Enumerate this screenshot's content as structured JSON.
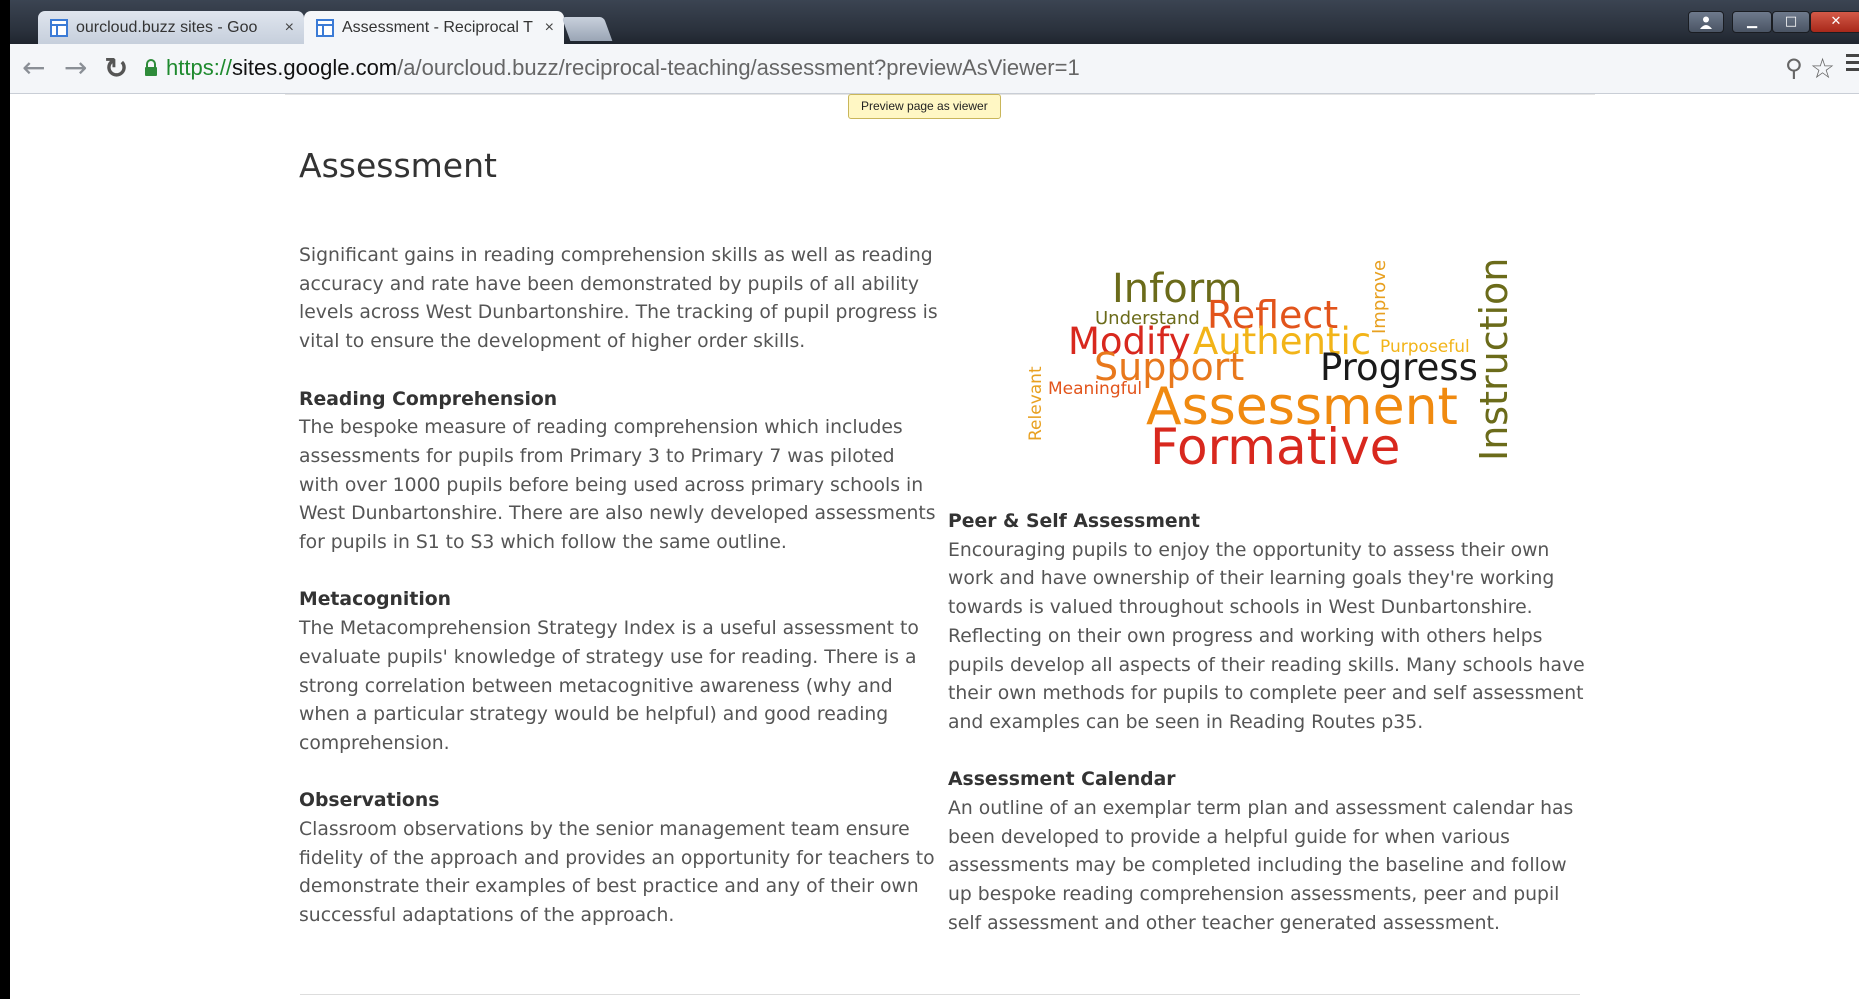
{
  "browser": {
    "tabs": [
      {
        "title": "ourcloud.buzz sites - Goo",
        "active": false
      },
      {
        "title": "Assessment - Reciprocal T",
        "active": true
      }
    ],
    "tab_close_symbol": "×",
    "url": {
      "scheme": "https://",
      "host": "sites.google.com",
      "path": "/a/ourcloud.buzz/reciprocal-teaching/assessment?previewAsViewer=1"
    },
    "window_controls": {
      "minimize": "▁",
      "maximize": "□",
      "close": "✕"
    }
  },
  "tooltip": "Preview page as viewer",
  "page": {
    "title": "Assessment",
    "left_column": [
      {
        "heading": "",
        "text": "Significant gains in reading comprehension skills as well as reading accuracy and rate have been demonstrated by pupils of all ability levels across West Dunbartonshire. The tracking of pupil progress is vital to ensure the development of higher order skills."
      },
      {
        "heading": "Reading Comprehension",
        "text": "The bespoke measure of reading comprehension which includes assessments for pupils from Primary 3 to Primary 7 was piloted with over 1000 pupils before being used across primary schools in West Dunbartonshire. There are also newly developed assessments for pupils in S1 to S3 which follow the same outline."
      },
      {
        "heading": "Metacognition",
        "text": "The Metacomprehension Strategy Index is a useful assessment to evaluate pupils' knowledge of strategy use for reading. There is a strong correlation between metacognitive awareness (why and when a particular strategy would be helpful) and good reading comprehension."
      },
      {
        "heading": "Observations",
        "text": "Classroom observations by the senior management team ensure fidelity of the approach and provides an opportunity for teachers to demonstrate their examples of best practice and any of their own successful adaptations of the approach."
      }
    ],
    "right_column": [
      {
        "heading": "Peer & Self Assessment",
        "text": "Encouraging pupils to enjoy the opportunity to assess their own work and have ownership of their learning goals they're working towards is valued throughout schools in West Dunbartonshire. Reflecting on their own progress and working with others helps pupils develop all aspects of their reading skills. Many schools have their own methods for pupils to complete peer and self assessment and examples can be seen in Reading Routes p35."
      },
      {
        "heading": "Assessment Calendar",
        "text": "An outline of an exemplar term plan and assessment calendar has been developed to provide a helpful guide for when various assessments may be completed including the baseline and follow up bespoke reading comprehension assessments, peer and pupil self assessment and other teacher generated assessment."
      }
    ],
    "word_cloud": {
      "words": [
        {
          "text": "Inform",
          "color": "#6b6b1a"
        },
        {
          "text": "Understand",
          "color": "#6b6b1a"
        },
        {
          "text": "Reflect",
          "color": "#e2541b"
        },
        {
          "text": "Improve",
          "color": "#e8a020"
        },
        {
          "text": "Instruction",
          "color": "#6b6b1a"
        },
        {
          "text": "Modify",
          "color": "#d8281e"
        },
        {
          "text": "Authentic",
          "color": "#f2b418"
        },
        {
          "text": "Purposeful",
          "color": "#f2b418"
        },
        {
          "text": "Support",
          "color": "#e8781c"
        },
        {
          "text": "Progress",
          "color": "#1a1a1a"
        },
        {
          "text": "Relevant",
          "color": "#e8a020"
        },
        {
          "text": "Meaningful",
          "color": "#e2541b"
        },
        {
          "text": "Assessment",
          "color": "#f08a10"
        },
        {
          "text": "Formative",
          "color": "#d8281e"
        }
      ]
    }
  }
}
